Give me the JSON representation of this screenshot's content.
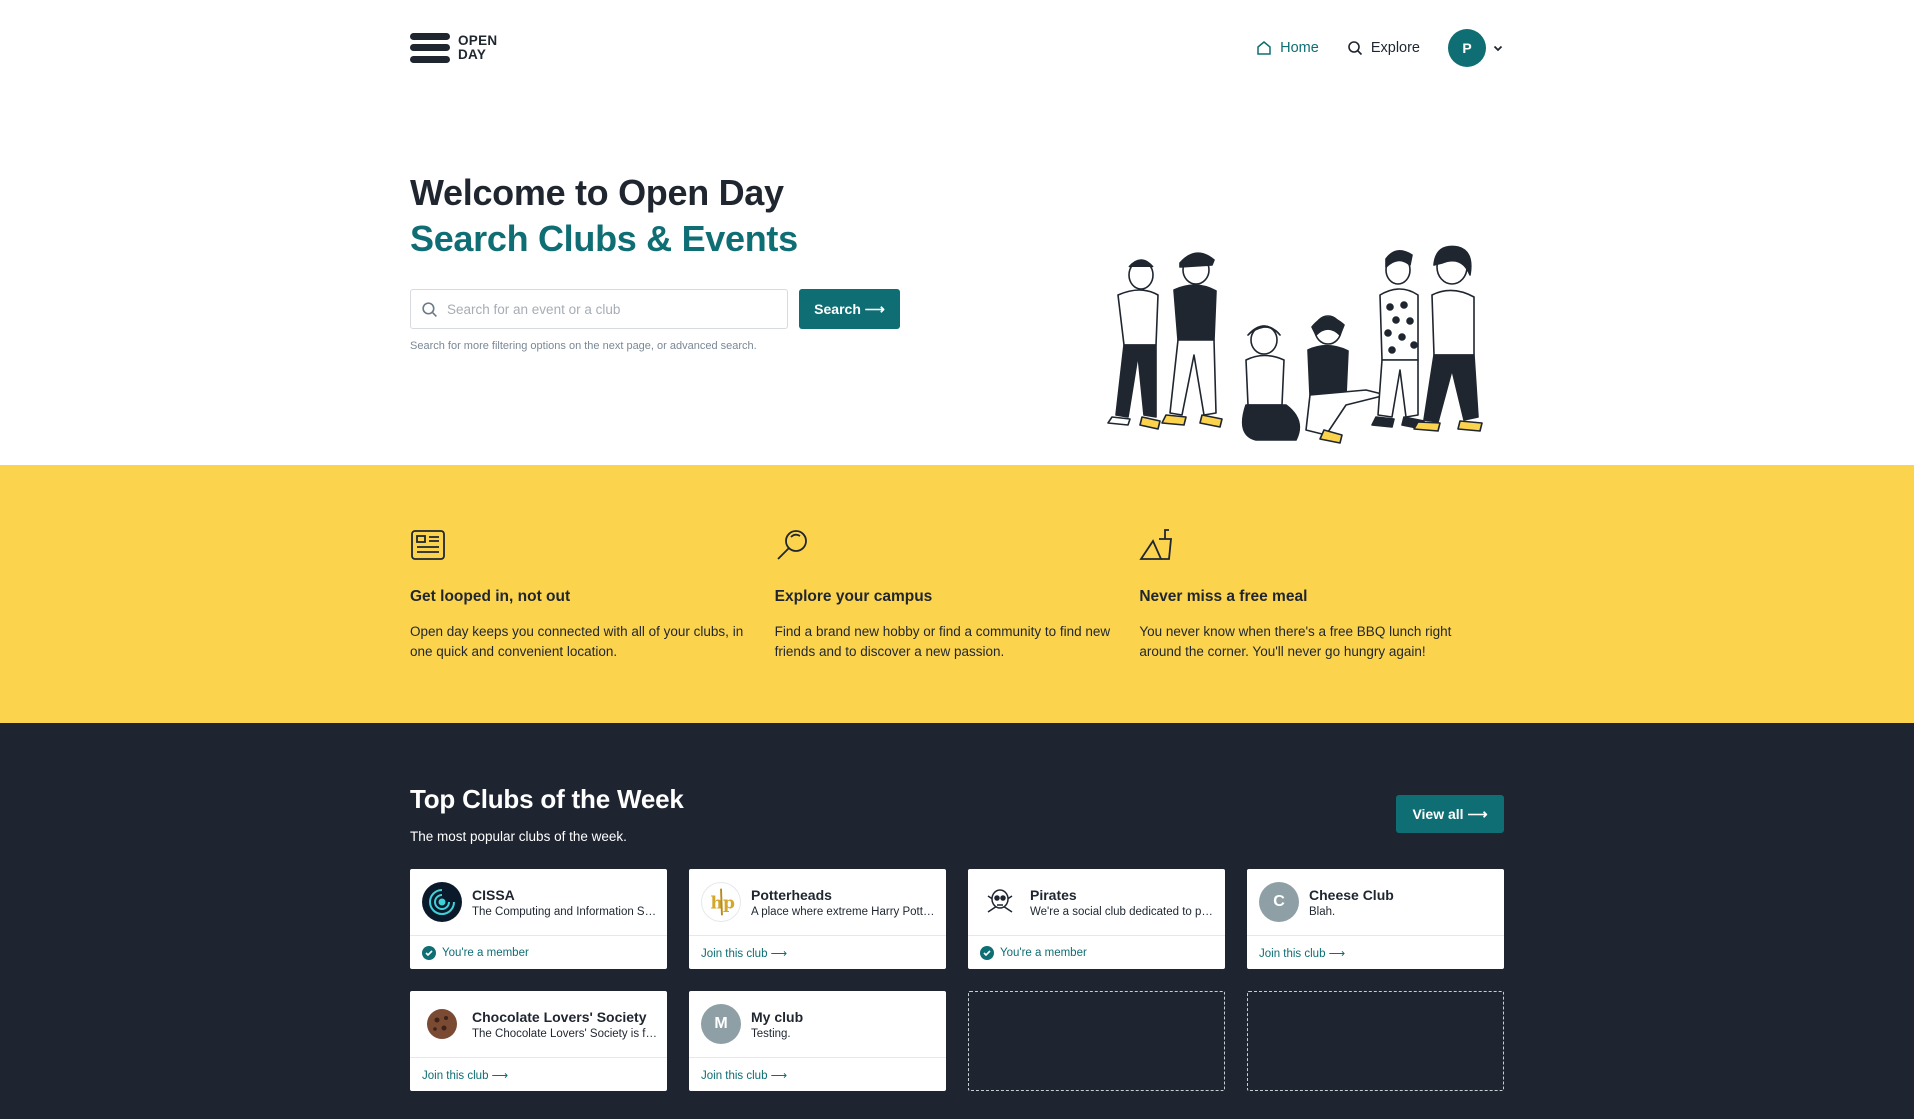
{
  "header": {
    "logo_line1": "OPEN",
    "logo_line2": "DAY",
    "nav": [
      {
        "label": "Home",
        "icon": "home-icon",
        "active": true
      },
      {
        "label": "Explore",
        "icon": "search-icon",
        "active": false
      }
    ],
    "avatar_initial": "P"
  },
  "hero": {
    "title": "Welcome to Open Day",
    "subtitle": "Search Clubs & Events",
    "search_placeholder": "Search for an event or a club",
    "search_button": "Search ⟶",
    "hint": "Search for more filtering options on the next page, or advanced search."
  },
  "features": [
    {
      "icon": "newspaper-icon",
      "title": "Get looped in, not out",
      "text": "Open day keeps you connected with all of your clubs, in one quick and convenient location."
    },
    {
      "icon": "magnifier-icon",
      "title": "Explore your campus",
      "text": "Find a brand new hobby or find a community to find new friends and to discover a new passion."
    },
    {
      "icon": "food-icon",
      "title": "Never miss a free meal",
      "text": "You never know when there's a free BBQ lunch right around the corner. You'll never go hungry again!"
    }
  ],
  "clubs": {
    "title": "Top Clubs of the Week",
    "subtitle": "The most popular clubs of the week.",
    "view_all": "View all ⟶",
    "items": [
      {
        "name": "CISSA",
        "desc": "The Computing and Information Systems Students Association",
        "status": "You're a member",
        "member": true,
        "avatar": "cissa-logo",
        "color": "#0b1a2a"
      },
      {
        "name": "Potterheads",
        "desc": "A place where extreme Harry Potter fans meet",
        "status": "Join this club ⟶",
        "member": false,
        "avatar": "potterheads-logo",
        "color": "#ffffff"
      },
      {
        "name": "Pirates",
        "desc": "We're a social club dedicated to pirates",
        "status": "You're a member",
        "member": true,
        "avatar": "pirates-logo",
        "color": "#ffffff"
      },
      {
        "name": "Cheese Club",
        "desc": "Blah.",
        "status": "Join this club ⟶",
        "member": false,
        "avatar": "C",
        "color": "#8ea0a6"
      },
      {
        "name": "Chocolate Lovers' Society",
        "desc": "The Chocolate Lovers' Society is for chocolate fans",
        "status": "Join this club ⟶",
        "member": false,
        "avatar": "chocolate-logo",
        "color": "#ffffff"
      },
      {
        "name": "My club",
        "desc": "Testing.",
        "status": "Join this club ⟶",
        "member": false,
        "avatar": "M",
        "color": "#8ea0a6"
      }
    ]
  }
}
